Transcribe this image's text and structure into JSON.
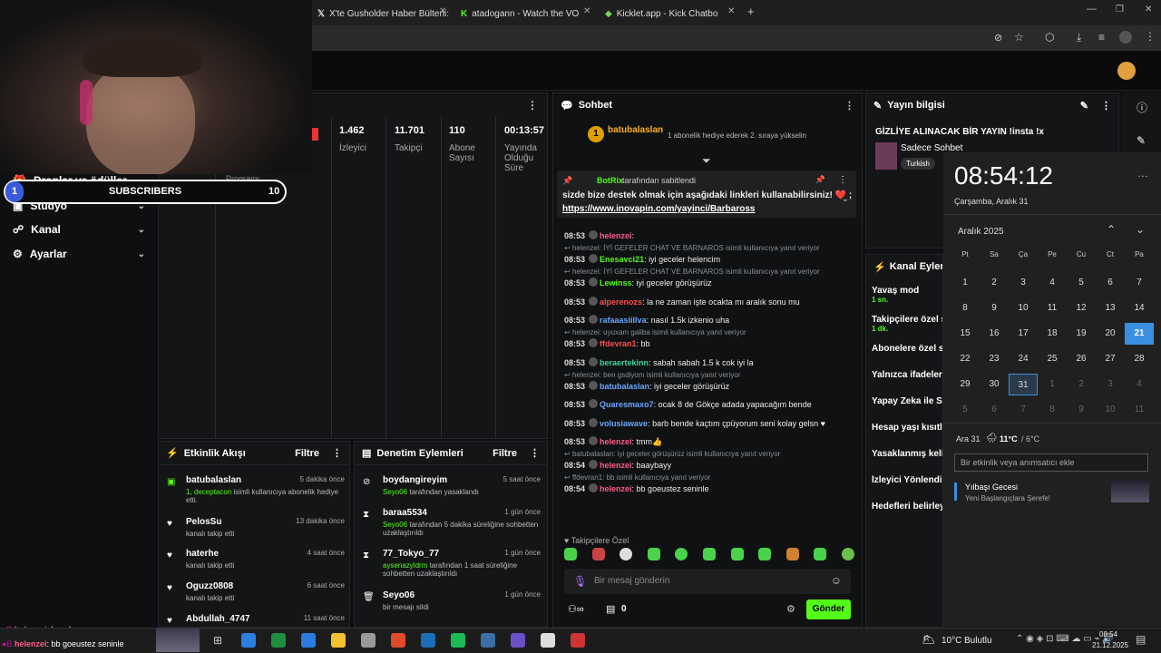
{
  "tabs": [
    {
      "label": "X'te Gusholder Haber Bülteni: \""
    },
    {
      "label": "atadogann - Watch the VOD on"
    },
    {
      "label": "Kicklet.app - Kick Chatbot and"
    }
  ],
  "stream_stats": [
    {
      "value": "1.462",
      "label": "İzleyici"
    },
    {
      "value": "11.701",
      "label": "Takipçi"
    },
    {
      "value": "110",
      "label": "Abone Sayısı"
    },
    {
      "value": "00:13:57",
      "label": "Yayında Olduğu Süre"
    }
  ],
  "overlay": {
    "sub_count_left": "1",
    "sub_label": "SUBSCRIBERS",
    "sub_count_right": "10"
  },
  "sidebar": {
    "items": [
      {
        "label": "Droplar ve ödüller"
      },
      {
        "label": "Stüdyo"
      },
      {
        "label": "Kanal"
      },
      {
        "label": "Ayarlar"
      }
    ],
    "program_label": "Programı"
  },
  "activity": {
    "title": "Etkinlik Akışı",
    "filter": "Filtre",
    "items": [
      {
        "name": "batubalaslan",
        "time": "5 dakika önce",
        "sub": "1, deceptacon",
        "sub2": " isimli kullanıcıya abonelik hediye etti."
      },
      {
        "name": "PelosSu",
        "time": "13 dakika önce",
        "sub": "kanalı takip etti"
      },
      {
        "name": "haterhe",
        "time": "4 saat önce",
        "sub": "kanalı takip etti"
      },
      {
        "name": "Oguzz0808",
        "time": "6 saat önce",
        "sub": "kanalı takip etti"
      },
      {
        "name": "Abdullah_4747",
        "time": "11 saat önce",
        "sub": ""
      }
    ]
  },
  "moderation": {
    "title": "Denetim Eylemleri",
    "filter": "Filtre",
    "items": [
      {
        "name": "boydangireyim",
        "time": "5 saat önce",
        "mod": "Seyo06",
        "text": " tarafından yasaklandı"
      },
      {
        "name": "baraa5534",
        "time": "1 gün önce",
        "mod": "Seyo06",
        "text": " tarafından 5 dakika süreliğine sohbetten uzaklaştırıldı"
      },
      {
        "name": "77_Tokyo_77",
        "time": "1 gün önce",
        "mod": "aysenazyldrm",
        "text": " tarafından 1 saat süreliğine sohbetten uzaklaştırıldı"
      },
      {
        "name": "Seyo06",
        "time": "1 gün önce",
        "mod": "",
        "text": "bir mesajı sildi"
      }
    ]
  },
  "chat": {
    "title": "Sohbet",
    "top_user": "batubalaslan",
    "top_count": "1",
    "top_text": "1 abonelik hediye ederek 2. sıraya yükselin",
    "pinned_by": "BotRix",
    "pinned_by_suffix": " tarafından sabitlendi",
    "pinned_text": "sizde bize destek olmak için aşağıdaki linkleri kullanabilirsiniz! ❤️ ;",
    "pinned_link": "https://www.inovapin.com/yayinci/Barbaross",
    "messages": [
      {
        "time": "08:53",
        "user": "helenzei",
        "color": "#ff5b8a",
        "text": ":"
      },
      {
        "reply": "helenzei: İYİ GEFELER CHAT VE BARNAROS isimli kullanıcıya yanıt veriyor"
      },
      {
        "time": "08:53",
        "user": "Enesavci21",
        "color": "#53fc18",
        "text": ": iyi geceler helencim"
      },
      {
        "reply": "helenzei: İYİ GEFELER CHAT VE BARNAROS isimli kullanıcıya yanıt veriyor"
      },
      {
        "time": "08:53",
        "user": "Lewinss",
        "color": "#53fc18",
        "text": ": iyi geceler görüşürüz"
      },
      {
        "time": "08:53",
        "user": "alperenozs",
        "color": "#ff4d4d",
        "text": ": la ne zaman işte ocakta mı aralık sonu mu"
      },
      {
        "time": "08:53",
        "user": "rafaaasiillva",
        "color": "#6aa7ff",
        "text": ": nasıl 1.5k izkenio uha"
      },
      {
        "reply": "helenzei: uyuxam galiba isimli kullanıcıya yanıt veriyor"
      },
      {
        "time": "08:53",
        "user": "ffdevran1",
        "color": "#ff4d4d",
        "text": ": bb"
      },
      {
        "time": "08:53",
        "user": "beraertekinn",
        "color": "#3fd4a0",
        "text": ": sabah sabah 1.5 k cok iyi la"
      },
      {
        "reply": "helenzei: ben gsdiyom isimli kullanıcıya yanıt veriyor"
      },
      {
        "time": "08:53",
        "user": "batubalaslan",
        "color": "#6aa7ff",
        "text": ": iyi geceler görüşürüz"
      },
      {
        "time": "08:53",
        "user": "Quaresmaxo7",
        "color": "#6aa7ff",
        "text": ": ocak 8 de Gökçe adada yapacağım bende"
      },
      {
        "time": "08:53",
        "user": "volusiawave",
        "color": "#6aa7ff",
        "text": ": barb bende kaçtım çpüyorum seni kolay gelsn ♥"
      },
      {
        "time": "08:53",
        "user": "helenzei",
        "color": "#ff5b8a",
        "text": ": tmm👍"
      },
      {
        "reply": "batubalaslan: iyi geceler görüşürüz isimli kullanıcıya yanıt veriyor"
      },
      {
        "time": "08:54",
        "user": "helenzei",
        "color": "#ff5b8a",
        "text": ": baaybayy"
      },
      {
        "reply": "ffdevran1: bb isimli kullanıcıya yanıt veriyor"
      },
      {
        "time": "08:54",
        "user": "helenzei",
        "color": "#ff5b8a",
        "text": ": bb goeustez seninle"
      }
    ],
    "followers_only": "Takipçilere Özel",
    "input_placeholder": "Bir mesaj gönderin",
    "points": "0",
    "send": "Gönder"
  },
  "stream_info": {
    "title": "Yayın bilgisi",
    "stream_title": "GİZLİYE ALINACAK BİR YAYIN !insta !x",
    "category": "Sadece Sohbet",
    "language": "Turkish"
  },
  "channel_actions": {
    "title": "Kanal Eylemleri",
    "items": [
      {
        "label": "Yavaş mod",
        "sub": "1 sn."
      },
      {
        "label": "Takipçilere özel s",
        "sub": "1 dk."
      },
      {
        "label": "Abonelere özel so",
        "sub": ""
      },
      {
        "label": "Yalnızca ifadeleri",
        "sub": ""
      },
      {
        "label": "Yapay Zeka ile So",
        "sub": ""
      },
      {
        "label": "Hesap yaşı kısıtla",
        "sub": ""
      },
      {
        "label": "Yasaklanmış kelin",
        "sub": ""
      },
      {
        "label": "İzleyici Yönlendir",
        "sub": ""
      },
      {
        "label": "Hedefleri belirleyi",
        "sub": ""
      }
    ]
  },
  "calendar": {
    "time": "08:54:12",
    "date": "Çarşamba, Aralık 31",
    "month": "Aralık 2025",
    "weekdays": [
      "Pt",
      "Sa",
      "Ça",
      "Pe",
      "Cu",
      "Ct",
      "Pa"
    ],
    "weeks": [
      [
        "1",
        "2",
        "3",
        "4",
        "5",
        "6",
        "7"
      ],
      [
        "8",
        "9",
        "10",
        "11",
        "12",
        "13",
        "14"
      ],
      [
        "15",
        "16",
        "17",
        "18",
        "19",
        "20",
        "21"
      ],
      [
        "22",
        "23",
        "24",
        "25",
        "26",
        "27",
        "28"
      ],
      [
        "29",
        "30",
        "31",
        "1",
        "2",
        "3",
        "4"
      ],
      [
        "5",
        "6",
        "7",
        "8",
        "9",
        "10",
        "11"
      ]
    ],
    "weather_day": "Ara 31",
    "weather_hi": "11°C",
    "weather_lo": "/ 6°C",
    "event_placeholder": "Bir etkinlik veya anımsatıcı ekle",
    "event_title": "Yılbaşı Gecesi",
    "event_sub": "Yeni Başlangıçlara Şerefe!"
  },
  "ticker": [
    {
      "user": "helenzei",
      "text": ": baaybayy"
    },
    {
      "user": "helenzei",
      "text": ": bb goeustez seninle"
    }
  ],
  "taskbar": {
    "weather": "10°C",
    "weather_label": "Bulutlu",
    "time": "08:54",
    "date": "21.12.2025"
  }
}
